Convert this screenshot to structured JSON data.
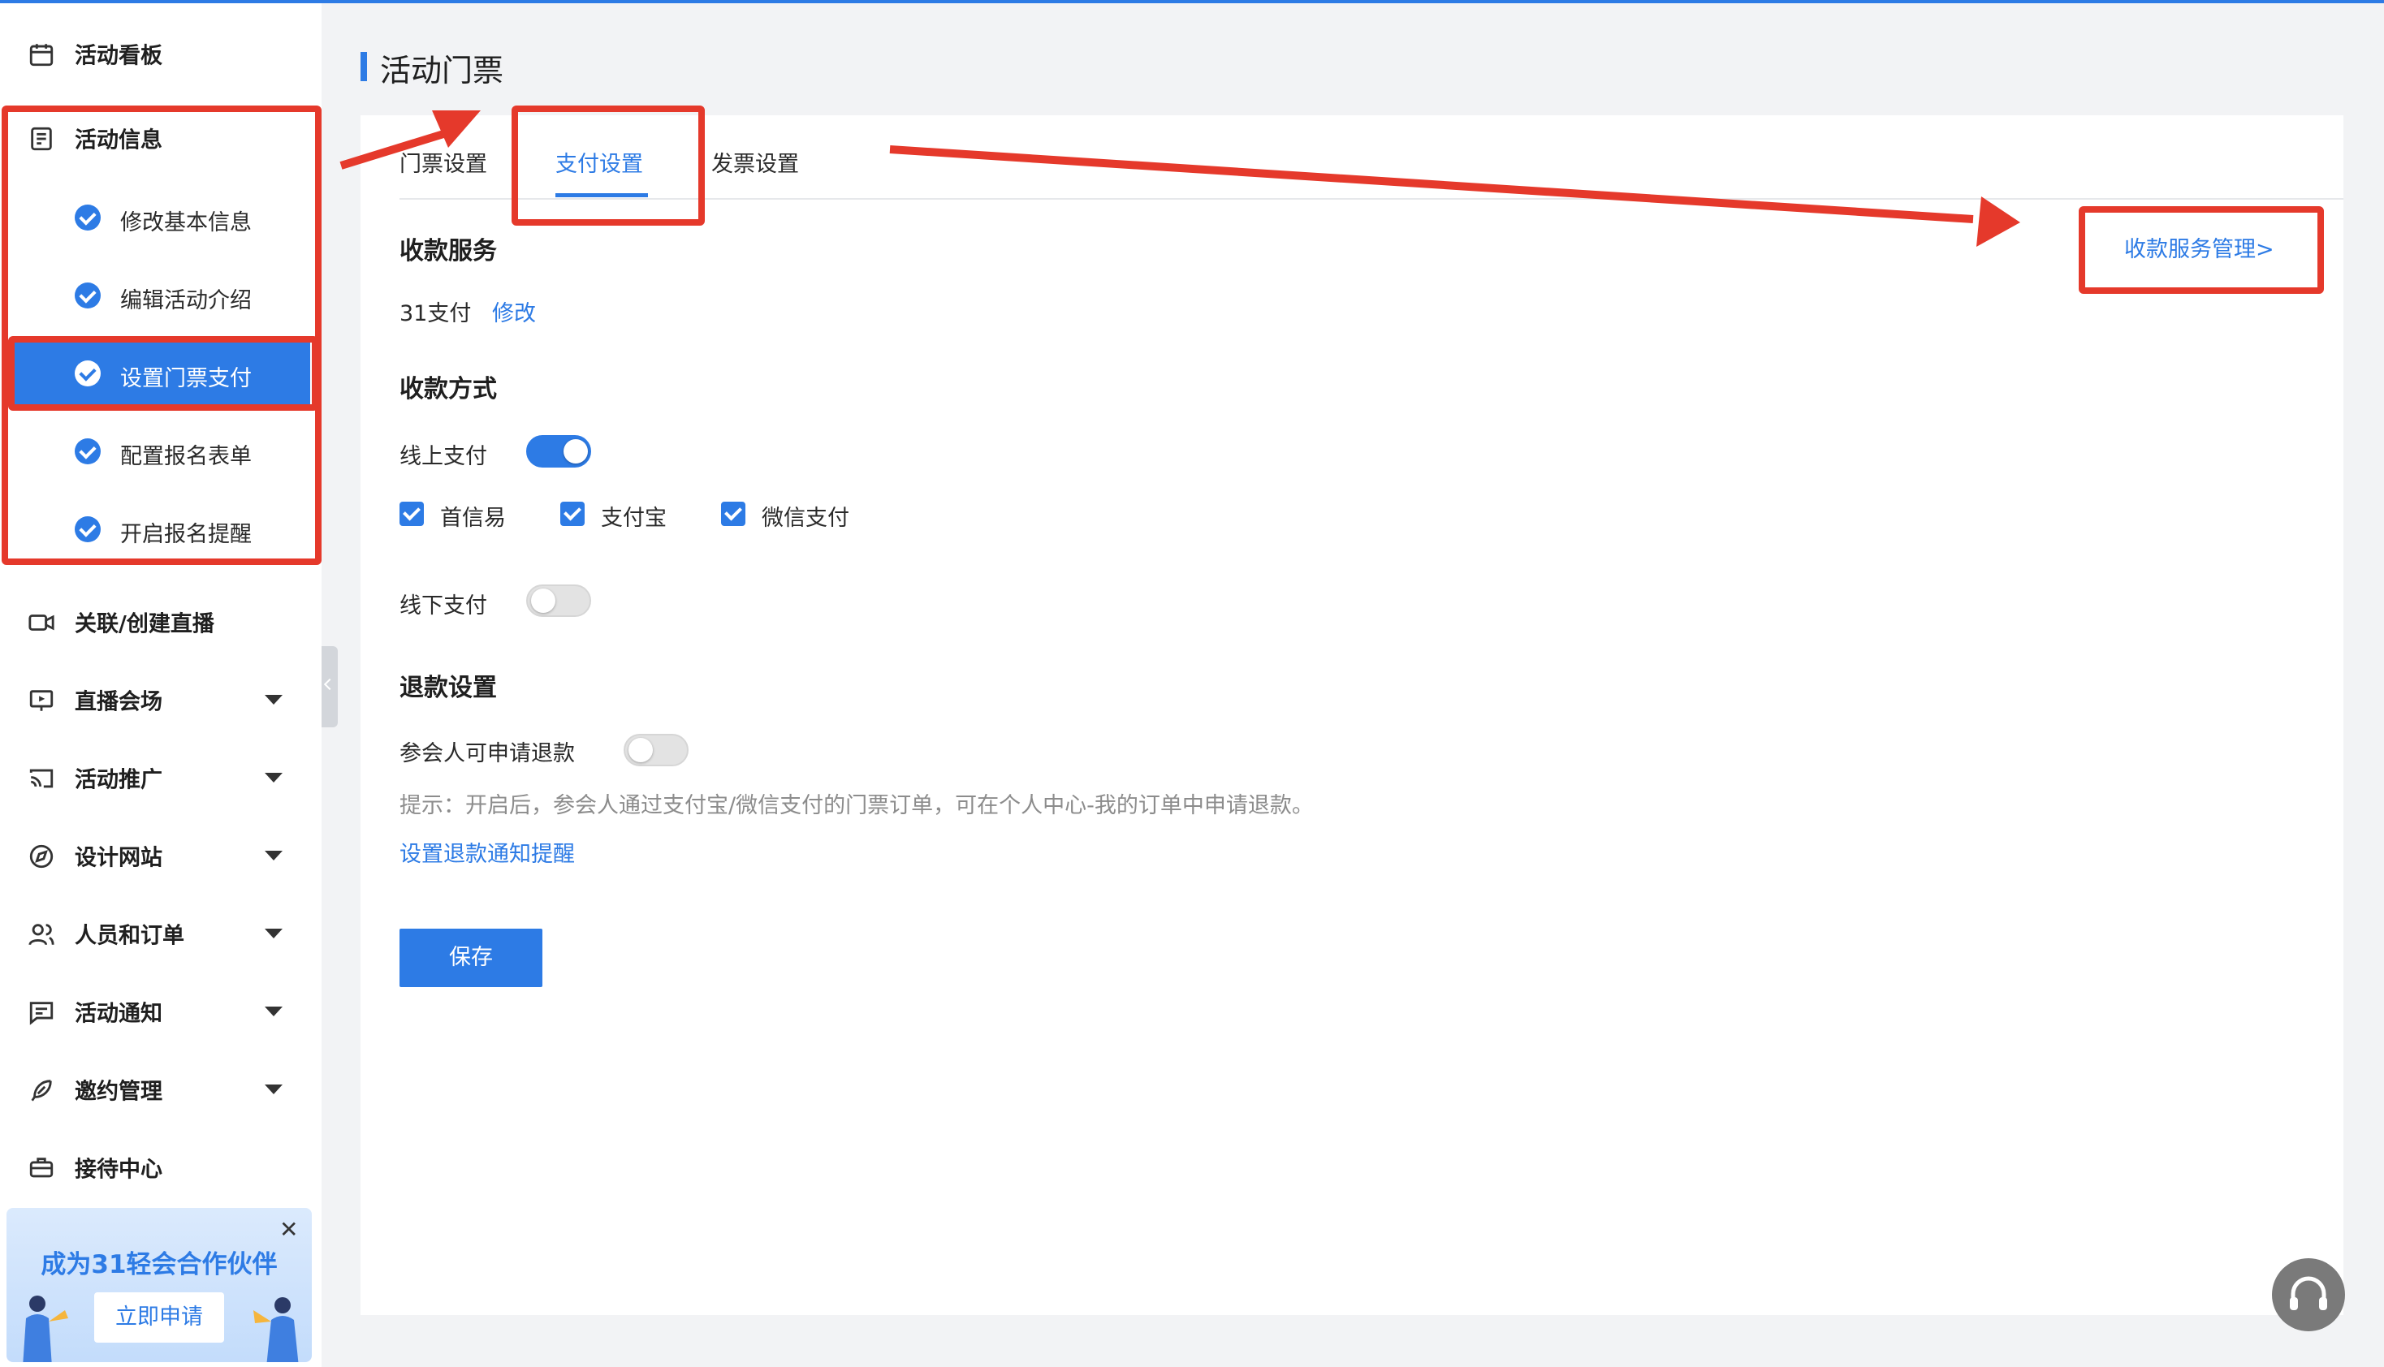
{
  "sidebar": {
    "items": [
      {
        "label": "活动看板",
        "icon": "calendar-icon"
      },
      {
        "label": "活动信息",
        "icon": "document-icon"
      },
      {
        "label": "关联/创建直播",
        "icon": "video-camera-icon"
      },
      {
        "label": "直播会场",
        "icon": "broadcast-screen-icon"
      },
      {
        "label": "活动推广",
        "icon": "cast-icon"
      },
      {
        "label": "设计网站",
        "icon": "compass-icon"
      },
      {
        "label": "人员和订单",
        "icon": "users-icon"
      },
      {
        "label": "活动通知",
        "icon": "message-icon"
      },
      {
        "label": "邀约管理",
        "icon": "feather-icon"
      },
      {
        "label": "接待中心",
        "icon": "briefcase-icon"
      }
    ],
    "sub_items": [
      {
        "label": "修改基本信息"
      },
      {
        "label": "编辑活动介绍"
      },
      {
        "label": "设置门票支付",
        "active": true
      },
      {
        "label": "配置报名表单"
      },
      {
        "label": "开启报名提醒"
      }
    ],
    "promo": {
      "title": "成为31轻会合作伙伴",
      "button": "立即申请",
      "close": "✕"
    }
  },
  "main": {
    "page_title": "活动门票",
    "tabs": [
      {
        "label": "门票设置"
      },
      {
        "label": "支付设置",
        "active": true
      },
      {
        "label": "发票设置"
      }
    ],
    "manage_link": "收款服务管理>",
    "payment_service": {
      "title": "收款服务",
      "value": "31支付",
      "edit_link": "修改"
    },
    "payment_method": {
      "title": "收款方式",
      "online_label": "线上支付",
      "online_enabled": true,
      "options": [
        {
          "label": "首信易",
          "checked": true
        },
        {
          "label": "支付宝",
          "checked": true
        },
        {
          "label": "微信支付",
          "checked": true
        }
      ],
      "offline_label": "线下支付",
      "offline_enabled": false
    },
    "refund": {
      "title": "退款设置",
      "allow_label": "参会人可申请退款",
      "allow_enabled": false,
      "hint": "提示：开启后，参会人通过支付宝/微信支付的门票订单，可在个人中心-我的订单中申请退款。",
      "notify_link": "设置退款通知提醒"
    },
    "save_button": "保存"
  },
  "colors": {
    "accent": "#2d7be5",
    "annotation": "#e5392b"
  }
}
